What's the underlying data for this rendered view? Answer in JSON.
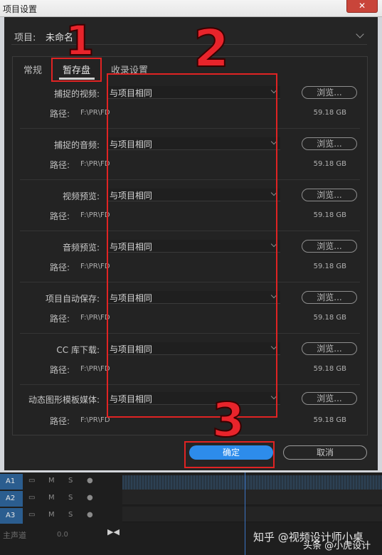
{
  "window": {
    "title": "项目设置",
    "close_label": "✕"
  },
  "project": {
    "label": "项目:",
    "value": "未命名"
  },
  "tabs": [
    {
      "label": "常规"
    },
    {
      "label": "暂存盘"
    },
    {
      "label": "收录设置"
    }
  ],
  "rows": [
    {
      "label": "捕捉的视频:",
      "value": "与项目相同",
      "browse": "浏览...",
      "path_label": "路径:",
      "path": "F:\\PR\\FD",
      "size": "59.18 GB"
    },
    {
      "label": "捕捉的音频:",
      "value": "与项目相同",
      "browse": "浏览...",
      "path_label": "路径:",
      "path": "F:\\PR\\FD",
      "size": "59.18 GB"
    },
    {
      "label": "视频预览:",
      "value": "与项目相同",
      "browse": "浏览...",
      "path_label": "路径:",
      "path": "F:\\PR\\FD",
      "size": "59.18 GB"
    },
    {
      "label": "音频预览:",
      "value": "与项目相同",
      "browse": "浏览...",
      "path_label": "路径:",
      "path": "F:\\PR\\FD",
      "size": "59.18 GB"
    },
    {
      "label": "项目自动保存:",
      "value": "与项目相同",
      "browse": "浏览...",
      "path_label": "路径:",
      "path": "F:\\PR\\FD",
      "size": "59.18 GB"
    },
    {
      "label": "CC 库下载:",
      "value": "与项目相同",
      "browse": "浏览...",
      "path_label": "路径:",
      "path": "F:\\PR\\FD",
      "size": "59.18 GB"
    },
    {
      "label": "动态图形模板媒体:",
      "value": "与项目相同",
      "browse": "浏览...",
      "path_label": "路径:",
      "path": "F:\\PR\\FD",
      "size": "59.18 GB"
    }
  ],
  "buttons": {
    "ok": "确定",
    "cancel": "取消"
  },
  "annotations": [
    "1",
    "2",
    "3"
  ],
  "timeline": {
    "tracks": [
      {
        "id": "A1",
        "m": "M",
        "s": "S"
      },
      {
        "id": "A2",
        "m": "M",
        "s": "S"
      },
      {
        "id": "A3",
        "m": "M",
        "s": "S"
      }
    ],
    "master_label": "主声道",
    "master_value": "0.0"
  },
  "watermark": {
    "line1": "知乎 @视频设计师小桌",
    "line2": "头条 @小虎设计"
  },
  "colors": {
    "accent": "#2d8ceb",
    "annotation": "#e02323"
  }
}
